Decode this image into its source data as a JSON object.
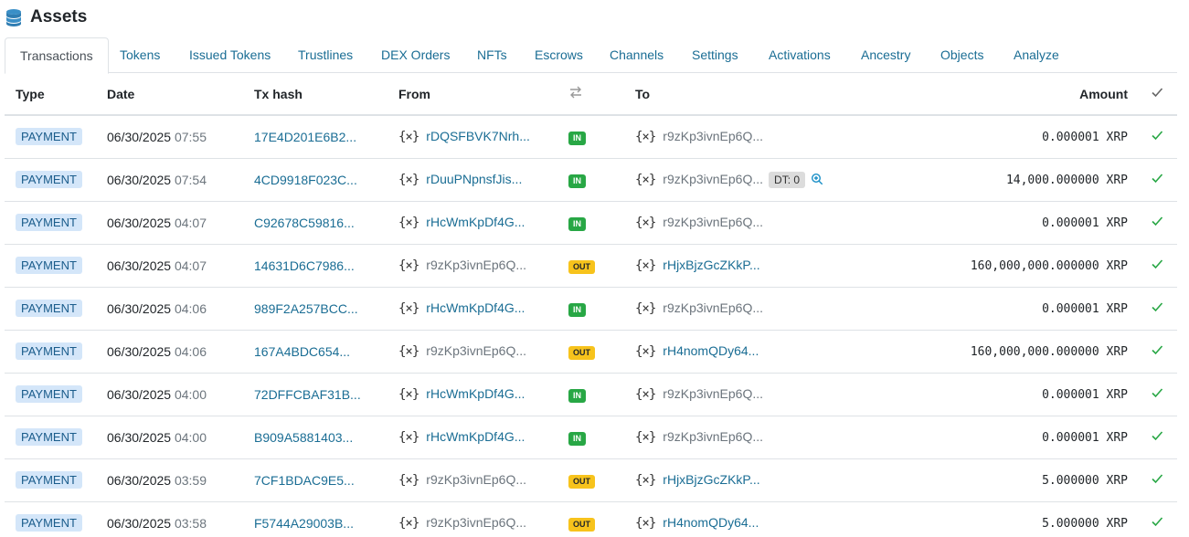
{
  "page": {
    "title": "Assets"
  },
  "tabs": [
    {
      "label": "Transactions",
      "active": true
    },
    {
      "label": "Tokens"
    },
    {
      "label": "Issued Tokens"
    },
    {
      "label": "Trustlines"
    },
    {
      "label": "DEX Orders"
    },
    {
      "label": "NFTs"
    },
    {
      "label": "Escrows"
    },
    {
      "label": "Channels"
    },
    {
      "label": "Settings"
    },
    {
      "label": "Activations"
    },
    {
      "label": "Ancestry"
    },
    {
      "label": "Objects"
    },
    {
      "label": "Analyze"
    }
  ],
  "table": {
    "headers": {
      "type": "Type",
      "date": "Date",
      "hash": "Tx hash",
      "from": "From",
      "to": "To",
      "amount": "Amount"
    },
    "rows": [
      {
        "type": "PAYMENT",
        "date": "06/30/2025",
        "time": "07:55",
        "hash": "17E4D201E6B2...",
        "from": "rDQSFBVK7Nrh...",
        "from_link": true,
        "dir": "IN",
        "to": "r9zKp3ivnEp6Q...",
        "to_link": false,
        "amount": "0.000001 XRP"
      },
      {
        "type": "PAYMENT",
        "date": "06/30/2025",
        "time": "07:54",
        "hash": "4CD9918F023C...",
        "from": "rDuuPNpnsfJis...",
        "from_link": true,
        "dir": "IN",
        "to": "r9zKp3ivnEp6Q...",
        "to_link": false,
        "dt": "DT: 0",
        "amount": "14,000.000000 XRP"
      },
      {
        "type": "PAYMENT",
        "date": "06/30/2025",
        "time": "04:07",
        "hash": "C92678C59816...",
        "from": "rHcWmKpDf4G...",
        "from_link": true,
        "dir": "IN",
        "to": "r9zKp3ivnEp6Q...",
        "to_link": false,
        "amount": "0.000001 XRP"
      },
      {
        "type": "PAYMENT",
        "date": "06/30/2025",
        "time": "04:07",
        "hash": "14631D6C7986...",
        "from": "r9zKp3ivnEp6Q...",
        "from_link": false,
        "dir": "OUT",
        "to": "rHjxBjzGcZKkP...",
        "to_link": true,
        "amount": "160,000,000.000000 XRP"
      },
      {
        "type": "PAYMENT",
        "date": "06/30/2025",
        "time": "04:06",
        "hash": "989F2A257BCC...",
        "from": "rHcWmKpDf4G...",
        "from_link": true,
        "dir": "IN",
        "to": "r9zKp3ivnEp6Q...",
        "to_link": false,
        "amount": "0.000001 XRP"
      },
      {
        "type": "PAYMENT",
        "date": "06/30/2025",
        "time": "04:06",
        "hash": "167A4BDC654...",
        "from": "r9zKp3ivnEp6Q...",
        "from_link": false,
        "dir": "OUT",
        "to": "rH4nomQDy64...",
        "to_link": true,
        "amount": "160,000,000.000000 XRP"
      },
      {
        "type": "PAYMENT",
        "date": "06/30/2025",
        "time": "04:00",
        "hash": "72DFFCBAF31B...",
        "from": "rHcWmKpDf4G...",
        "from_link": true,
        "dir": "IN",
        "to": "r9zKp3ivnEp6Q...",
        "to_link": false,
        "amount": "0.000001 XRP"
      },
      {
        "type": "PAYMENT",
        "date": "06/30/2025",
        "time": "04:00",
        "hash": "B909A5881403...",
        "from": "rHcWmKpDf4G...",
        "from_link": true,
        "dir": "IN",
        "to": "r9zKp3ivnEp6Q...",
        "to_link": false,
        "amount": "0.000001 XRP"
      },
      {
        "type": "PAYMENT",
        "date": "06/30/2025",
        "time": "03:59",
        "hash": "7CF1BDAC9E5...",
        "from": "r9zKp3ivnEp6Q...",
        "from_link": false,
        "dir": "OUT",
        "to": "rHjxBjzGcZKkP...",
        "to_link": true,
        "amount": "5.000000 XRP"
      },
      {
        "type": "PAYMENT",
        "date": "06/30/2025",
        "time": "03:58",
        "hash": "F5744A29003B...",
        "from": "r9zKp3ivnEp6Q...",
        "from_link": false,
        "dir": "OUT",
        "to": "rH4nomQDy64...",
        "to_link": true,
        "amount": "5.000000 XRP"
      }
    ]
  },
  "icons": {
    "header": "database-icon",
    "direction_header": "swap-arrows-icon",
    "status_header": "checkmark-icon",
    "address": "x-address-icon",
    "zoom": "magnifier-plus-icon",
    "success": "checkmark-icon"
  },
  "colors": {
    "link": "#1a6d94",
    "in_badge": "#28a745",
    "out_badge": "#f7c31c",
    "type_badge_bg": "#d4e6f9",
    "success_check": "#28a745"
  }
}
